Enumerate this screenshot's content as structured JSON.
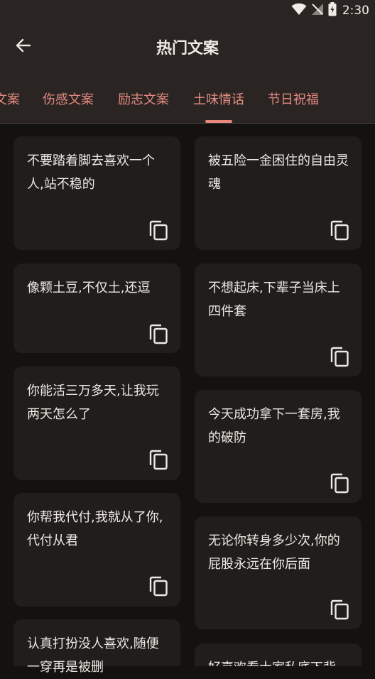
{
  "status_bar": {
    "time": "2:30"
  },
  "header": {
    "title": "热门文案"
  },
  "tabs": [
    {
      "label": "文案"
    },
    {
      "label": "伤感文案"
    },
    {
      "label": "励志文案"
    },
    {
      "label": "土味情话",
      "active": true
    },
    {
      "label": "节日祝福"
    }
  ],
  "cards": [
    {
      "text": "不要踏着脚去喜欢一个人,站不稳的"
    },
    {
      "text": "被五险一金困住的自由灵魂"
    },
    {
      "text": "像颗土豆,不仅土,还逗"
    },
    {
      "text": " 不想起床,下辈子当床上四件套"
    },
    {
      "text": "你能活三万多天,让我玩两天怎么了"
    },
    {
      "text": " 今天成功拿下一套房,我的破防"
    },
    {
      "text": "你帮我代付,我就从了你,代付从君"
    },
    {
      "text": "无论你转身多少次,你的屁股永远在你后面"
    },
    {
      "text": "认真打扮没人喜欢,随便一穿再是被删"
    },
    {
      "text": "好喜欢看大家私底下背"
    }
  ],
  "colors": {
    "background": "#131211",
    "appbar": "#2a2523",
    "card": "#201e1d",
    "accent": "#e8877b",
    "text": "#efe8e2"
  }
}
